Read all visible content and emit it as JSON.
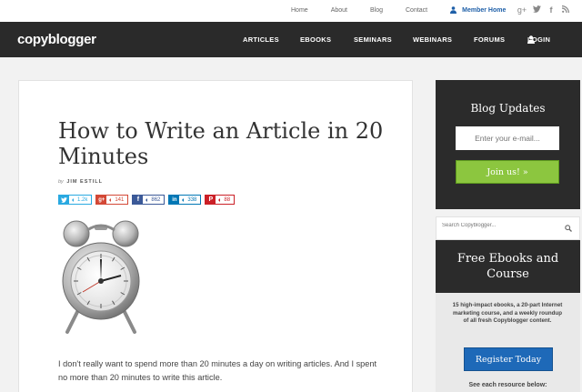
{
  "top_links": [
    "Home",
    "About",
    "Blog",
    "Contact"
  ],
  "member_home": "Member Home",
  "social": {
    "google_plus": "g+",
    "twitter": "t",
    "facebook": "f",
    "rss": "rss"
  },
  "brand": "copyblogger",
  "nav": [
    "ARTICLES",
    "EBOOKS",
    "SEMINARS",
    "WEBINARS",
    "FORUMS"
  ],
  "login": "LOGIN",
  "article": {
    "title": "How to Write an Article in 20 Minutes",
    "by": "by",
    "author": "JIM ESTILL",
    "shares": [
      {
        "network": "twitter",
        "icon": "t",
        "count": "1.2k",
        "color": "#29a9e1"
      },
      {
        "network": "google-plus",
        "icon": "g+",
        "count": "141",
        "color": "#d34836"
      },
      {
        "network": "facebook",
        "icon": "f",
        "count": "862",
        "color": "#3b5998"
      },
      {
        "network": "linkedin",
        "icon": "in",
        "count": "338",
        "color": "#0077b5"
      },
      {
        "network": "pinterest",
        "icon": "P",
        "count": "88",
        "color": "#cb2027"
      }
    ],
    "body": "I don't really want to spend more than 20 minutes a day on writing articles. And I spent no more than 20 minutes to write this article."
  },
  "sidebar": {
    "blog_updates_title": "Blog Updates",
    "email_placeholder": "Enter your e-mail...",
    "join_label": "Join us! »",
    "search_placeholder": "Search Copyblogger...",
    "ebooks_title": "Free Ebooks and Course",
    "ebooks_text": "15 high-impact ebooks, a 20-part Internet marketing course, and a weekly roundup of all fresh Copyblogger content.",
    "register_label": "Register Today",
    "see_each": "See each resource below:"
  },
  "colors": {
    "dark": "#2b2b2b",
    "green": "#8cc63f",
    "blue": "#1e69b8",
    "member_blue": "#1e5fa8"
  }
}
